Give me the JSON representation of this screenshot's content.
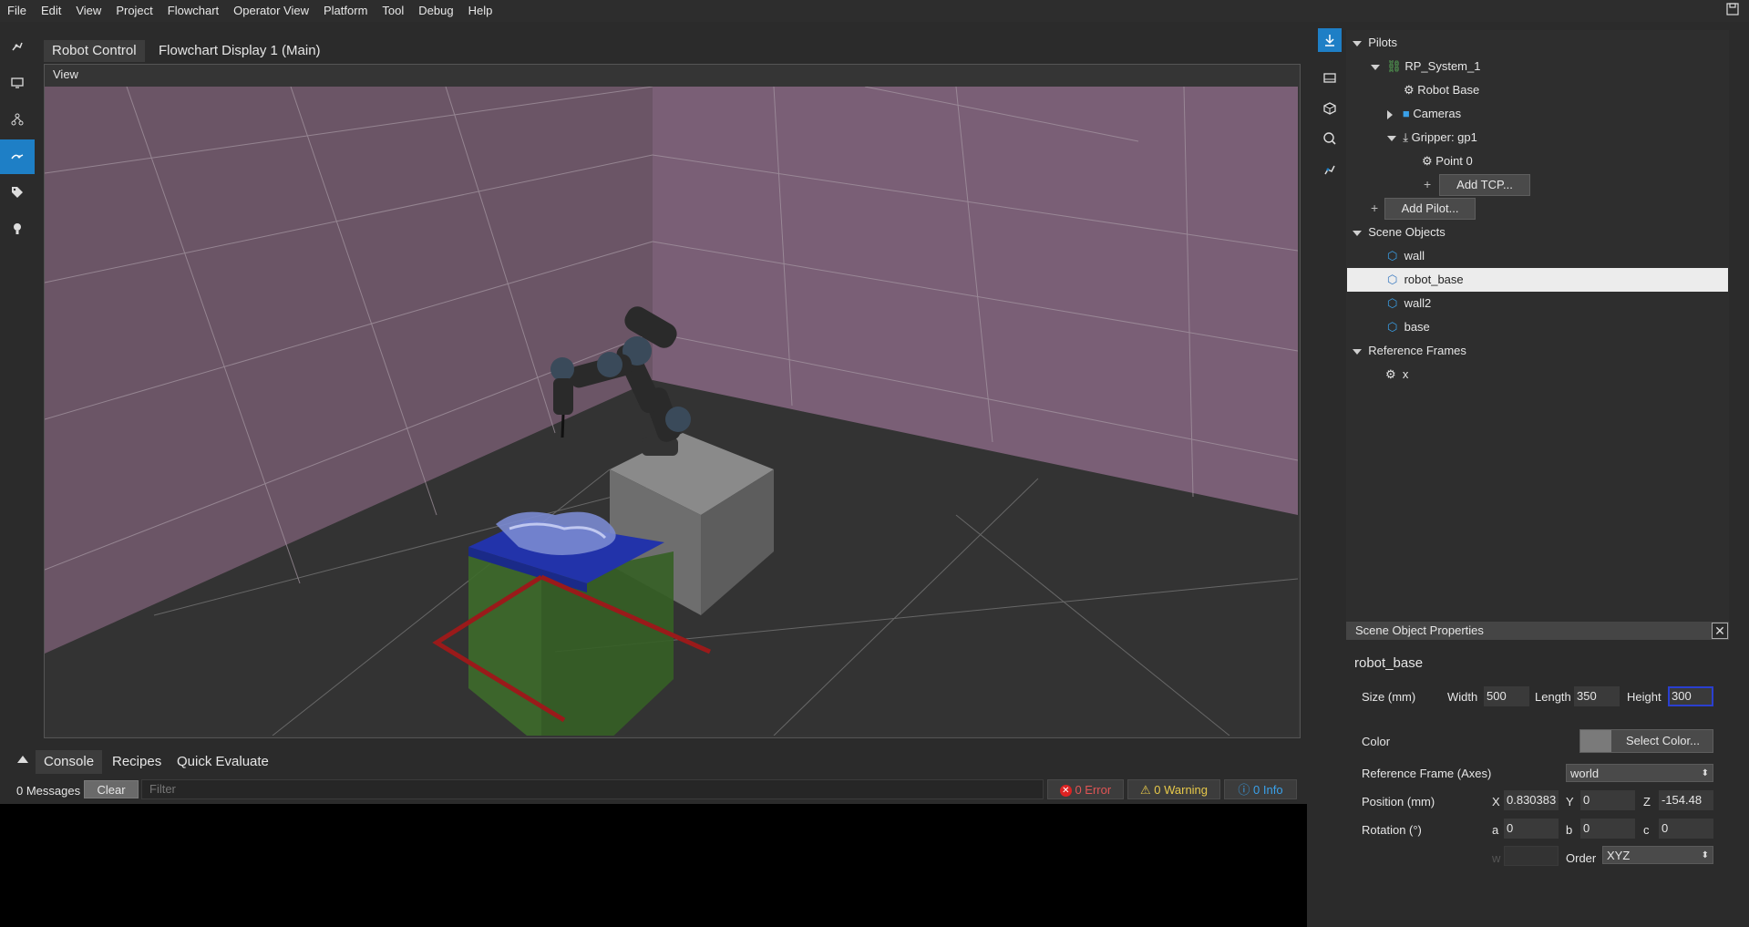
{
  "menu": [
    "File",
    "Edit",
    "View",
    "Project",
    "Flowchart",
    "Operator View",
    "Platform",
    "Tool",
    "Debug",
    "Help"
  ],
  "tabs": [
    "Robot Control",
    "Flowchart Display 1 (Main)"
  ],
  "viewport": {
    "label": "View"
  },
  "tree": {
    "pilots": "Pilots",
    "system": "RP_System_1",
    "robot_base": "Robot Base",
    "cameras": "Cameras",
    "gripper": "Gripper: gp1",
    "point0": "Point 0",
    "add_tcp": "Add TCP...",
    "add_pilot": "Add Pilot...",
    "scene_objects": "Scene Objects",
    "objects": [
      "wall",
      "robot_base",
      "wall2",
      "base"
    ],
    "reference_frames": "Reference Frames",
    "frames": [
      "x"
    ]
  },
  "props": {
    "header": "Scene Object Properties",
    "name": "robot_base",
    "size_label": "Size (mm)",
    "width_label": "Width",
    "width": "500",
    "length_label": "Length",
    "length": "350",
    "height_label": "Height",
    "height": "300",
    "color_label": "Color",
    "select_color": "Select Color...",
    "ref_frame_label": "Reference Frame (Axes)",
    "ref_frame": "world",
    "position_label": "Position (mm)",
    "x_label": "X",
    "x": "0.830383",
    "y_label": "Y",
    "y": "0",
    "z_label": "Z",
    "z": "-154.48",
    "rotation_label": "Rotation (°)",
    "a_label": "a",
    "a": "0",
    "b_label": "b",
    "b": "0",
    "c_label": "c",
    "c": "0",
    "w_label": "w",
    "order_label": "Order",
    "order": "XYZ"
  },
  "console": {
    "tabs": [
      "Console",
      "Recipes",
      "Quick Evaluate"
    ],
    "messages": "0 Messages",
    "clear": "Clear",
    "filter_placeholder": "Filter",
    "errors": "0 Error",
    "warnings": "0 Warning",
    "info": "0 Info"
  },
  "colors": {
    "accent": "#1e7fc6",
    "error": "#e05555",
    "warning": "#e6c84a",
    "info": "#3aa0e8",
    "wall": "#8a6b86",
    "robot_base_box": "#707070",
    "table_top": "#2233aa",
    "base_box": "#3d6a2a",
    "red_frame": "#9a1a1a"
  }
}
